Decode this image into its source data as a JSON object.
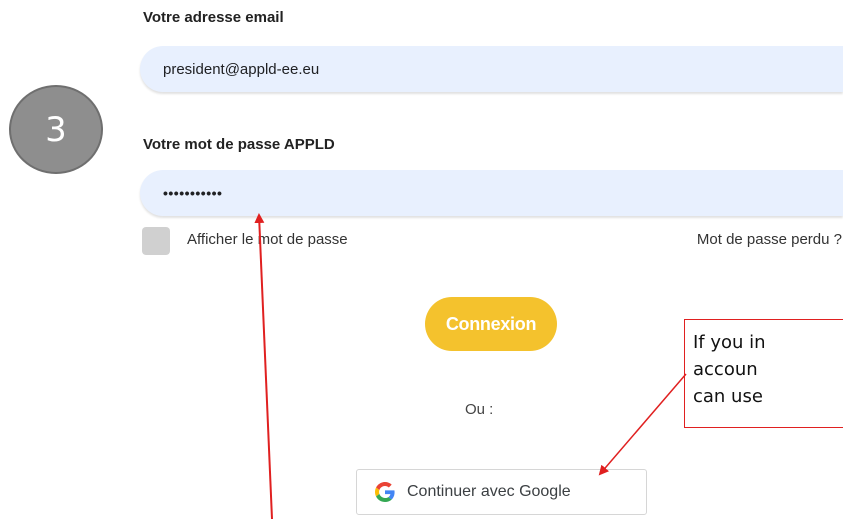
{
  "step_number": "3",
  "email": {
    "label": "Votre adresse email",
    "value": "president@appld-ee.eu"
  },
  "password": {
    "label": "Votre mot de passe APPLD",
    "value": "•••••••••••"
  },
  "show_password_label": "Afficher le mot de passe",
  "lost_password_label": "Mot de passe perdu ?",
  "connexion_label": "Connexion",
  "or_label": "Ou :",
  "google_button_label": "Continuer avec Google",
  "annotation": {
    "lines": [
      "If you in",
      "accoun",
      "can use"
    ]
  },
  "colors": {
    "field_bg": "#e8f0fe",
    "connexion_bg": "#f4c22d",
    "annotation_red": "#e02020",
    "step_circle": "#8e8e8e"
  }
}
